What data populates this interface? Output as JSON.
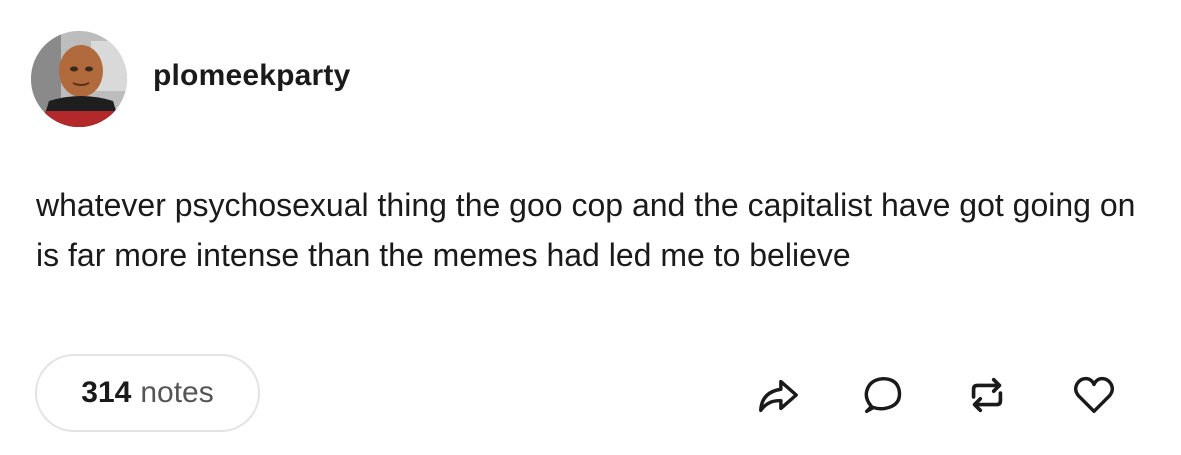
{
  "post": {
    "username": "plomeekparty",
    "body_text": "whatever psychosexual thing the goo cop and the capitalist have got going on is far more intense than the memes had led me to believe",
    "notes_count": "314",
    "notes_label": "notes"
  },
  "actions": [
    {
      "icon": "share-icon"
    },
    {
      "icon": "reply-icon"
    },
    {
      "icon": "reblog-icon"
    },
    {
      "icon": "like-heart-icon"
    }
  ],
  "colors": {
    "text": "#1a1a1a",
    "muted": "#555555",
    "pill_border": "#e3e3e3",
    "icon_stroke": "#1a1a1a"
  }
}
